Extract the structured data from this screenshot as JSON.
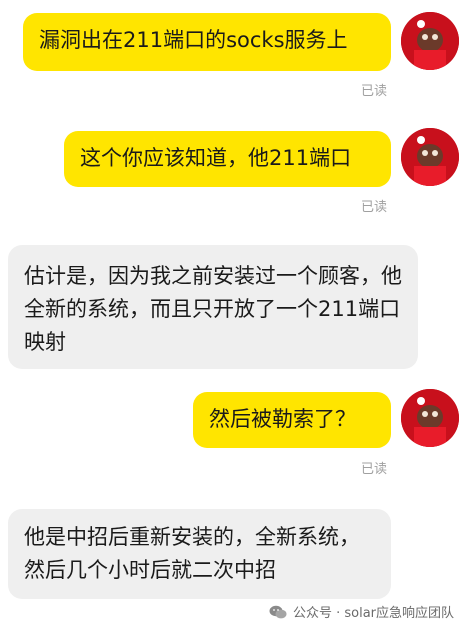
{
  "messages": [
    {
      "direction": "outgoing",
      "text": "漏洞出在211端口的socks服务上",
      "status": "已读"
    },
    {
      "direction": "outgoing",
      "text": "这个你应该知道，他211端口",
      "status": "已读"
    },
    {
      "direction": "incoming",
      "text": "估计是，因为我之前安装过一个顾客，他全新的系统，而且只开放了一个211端口映射"
    },
    {
      "direction": "outgoing",
      "text": "然后被勒索了？",
      "status": "已读"
    },
    {
      "direction": "incoming",
      "text": "他是中招后重新安装的，全新系统，然后几个小时后就二次中招"
    }
  ],
  "watermark": {
    "icon": "wechat-icon",
    "text": "公众号 · solar应急响应团队"
  },
  "colors": {
    "outgoing_bubble": "#ffe500",
    "incoming_bubble": "#efefef",
    "read_status": "#a0a0a0",
    "avatar_bg": "#c8101c"
  }
}
